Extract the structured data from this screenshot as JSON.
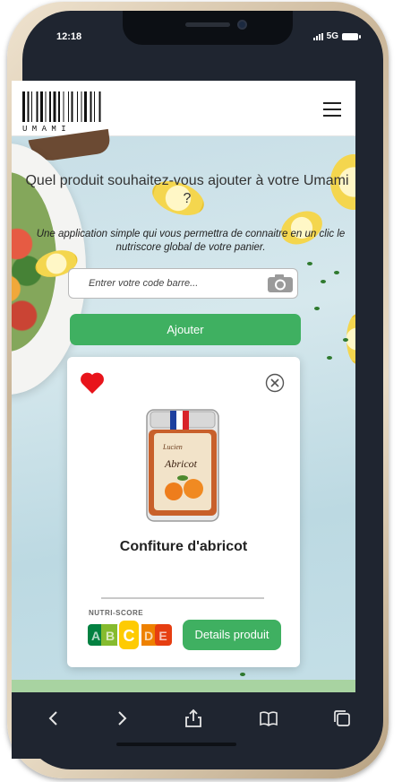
{
  "status_bar": {
    "time": "12:18",
    "network": "5G"
  },
  "header": {
    "logo_text": "U  M  A  M  I"
  },
  "hero": {
    "title": "Quel produit souhaitez-vous ajouter à votre Umami ?",
    "subtitle": "Une application simple qui vous permettra de connaitre en un clic le nutriscore global de votre panier."
  },
  "search": {
    "placeholder": "Entrer votre code barre..."
  },
  "add_button": {
    "label": "Ajouter"
  },
  "product_card": {
    "name": "Confiture d'abricot",
    "nutriscore_label": "NUTRI-SCORE",
    "nutriscore_letters": [
      "A",
      "B",
      "C",
      "D",
      "E"
    ],
    "nutriscore_grade": "C",
    "details_label": "Details produit",
    "favorite": true
  },
  "colors": {
    "accent_green": "#3fb061",
    "nutri_a": "#038141",
    "nutri_b": "#85bb2f",
    "nutri_c": "#fecb02",
    "nutri_d": "#ee8100",
    "nutri_e": "#e63e11",
    "heart": "#e8141b"
  },
  "toolbar": {
    "icons": [
      "back-icon",
      "forward-icon",
      "share-icon",
      "bookmarks-icon",
      "tabs-icon"
    ]
  }
}
